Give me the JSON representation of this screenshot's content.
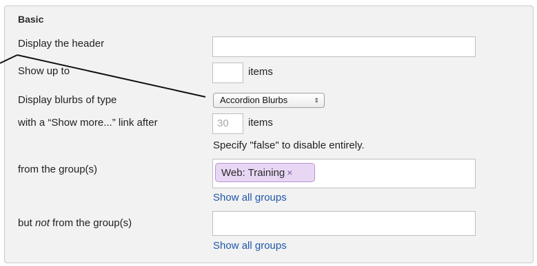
{
  "section": {
    "title": "Basic"
  },
  "rows": {
    "header": {
      "label": "Display the header",
      "value": ""
    },
    "show_up_to": {
      "label": "Show up to",
      "value": "",
      "unit": "items"
    },
    "blurbs": {
      "label": "Display blurbs of type",
      "selected": "Accordion Blurbs"
    },
    "show_more": {
      "label": "with a “Show more...” link after",
      "value": "30",
      "unit": "items",
      "hint": "Specify \"false\" to disable entirely."
    },
    "groups": {
      "label": "from the group(s)",
      "tag": "Web: Training",
      "tag_remove": "×",
      "link": "Show all groups"
    },
    "not_groups": {
      "label_prefix": "but ",
      "label_em": "not",
      "label_suffix": " from the group(s)",
      "value": "",
      "link": "Show all groups"
    }
  },
  "icons": {
    "select_arrows": "updown-chevron-icon",
    "tag_remove": "close-icon"
  },
  "colors": {
    "panel_bg": "#f2f2f2",
    "tag_bg": "#e8d7f4",
    "link": "#1f57a8"
  }
}
